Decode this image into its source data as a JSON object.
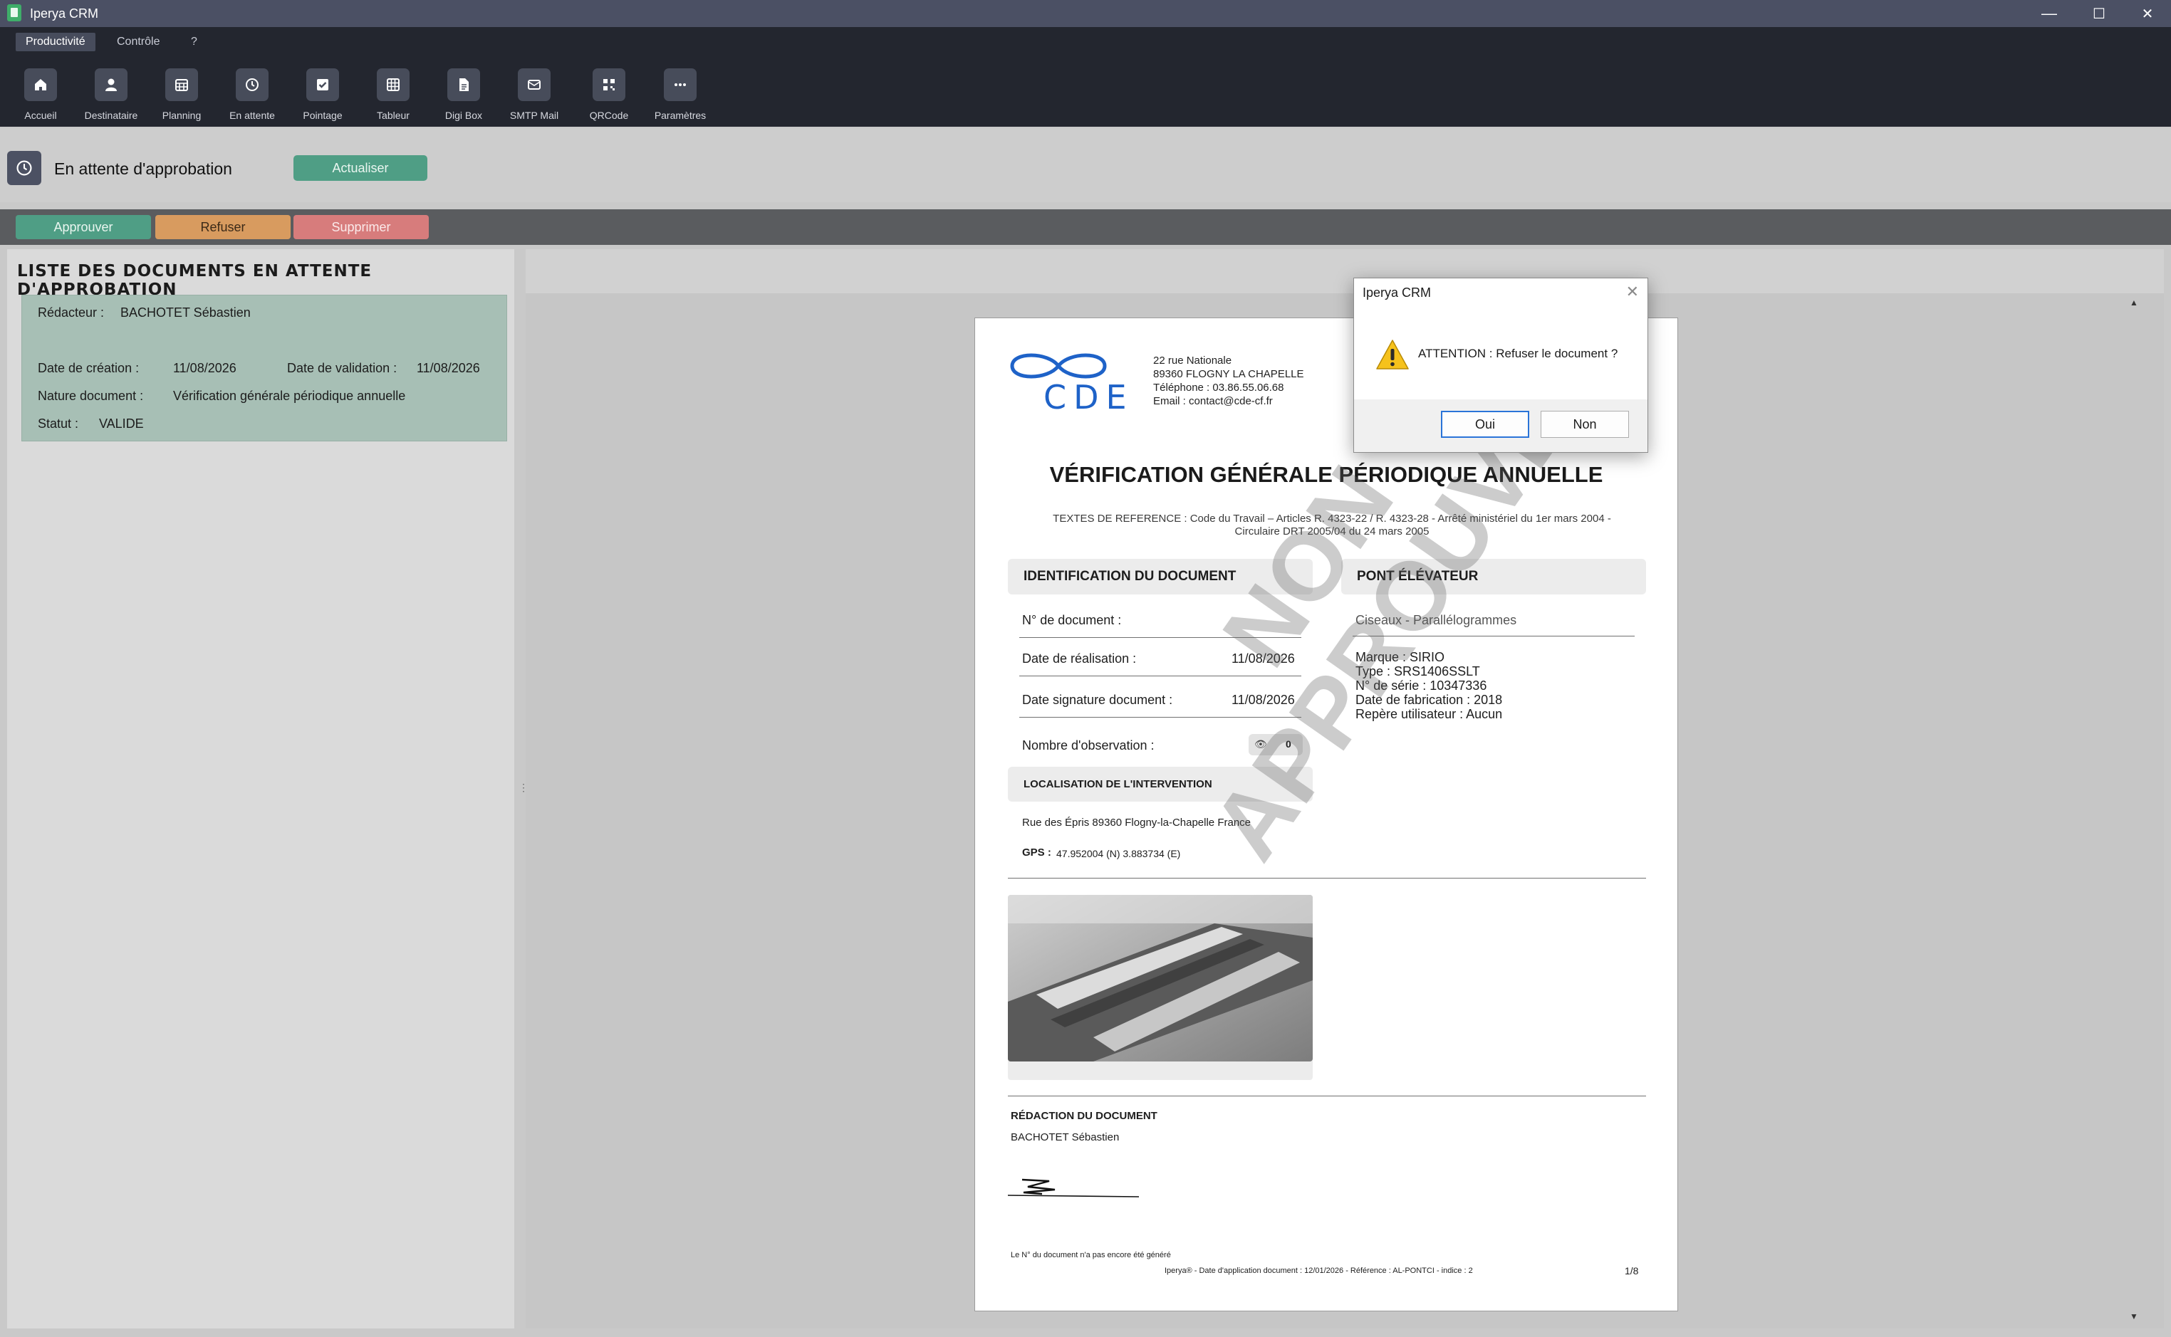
{
  "window": {
    "title": "Iperya CRM",
    "minimize": "—",
    "maximize": "☐",
    "close": "✕"
  },
  "menu": {
    "tabs": [
      "Productivité",
      "Contrôle",
      "?"
    ]
  },
  "ribbon": {
    "buttons": [
      {
        "label": "Accueil",
        "icon": "home-icon"
      },
      {
        "label": "Destinataire",
        "icon": "user-icon"
      },
      {
        "label": "Planning",
        "icon": "calendar-icon"
      },
      {
        "label": "En attente",
        "icon": "clock-icon"
      },
      {
        "label": "Pointage",
        "icon": "check-icon"
      },
      {
        "label": "Tableur",
        "icon": "grid-icon"
      },
      {
        "label": "Digi Box",
        "icon": "document-icon"
      },
      {
        "label": "SMTP Mail",
        "icon": "mail-icon"
      },
      {
        "label": "QRCode",
        "icon": "qrcode-icon"
      },
      {
        "label": "Paramètres",
        "icon": "more-icon"
      }
    ]
  },
  "header": {
    "title": "En attente d'approbation",
    "refresh_label": "Actualiser"
  },
  "actions": {
    "approve": "Approuver",
    "refuse": "Refuser",
    "delete": "Supprimer",
    "colors": {
      "approve": "#4f9e85",
      "refuse": "#d89b5f",
      "delete": "#d77c7c"
    }
  },
  "list": {
    "title": "LISTE DES DOCUMENTS EN ATTENTE D'APPROBATION",
    "item": {
      "author_label": "Rédacteur :",
      "author": "BACHOTET Sébastien",
      "created_label": "Date de création :",
      "created": "11/08/2026",
      "validated_label": "Date de validation :",
      "validated": "11/08/2026",
      "nature_label": "Nature document :",
      "nature": "Vérification générale périodique annuelle",
      "status_label": "Statut :",
      "status": "VALIDE"
    }
  },
  "document": {
    "company": {
      "logo_text": "CDE",
      "address1": "22 rue Nationale",
      "address2": "89360 FLOGNY LA CHAPELLE",
      "phone": "Téléphone : 03.86.55.06.68",
      "email": "Email : contact@cde-cf.fr"
    },
    "title": "VÉRIFICATION GÉNÉRALE PÉRIODIQUE ANNUELLE",
    "references": "TEXTES DE REFERENCE :  Code du Travail – Articles R. 4323-22 / R. 4323-28 - Arrêté ministériel du 1er mars 2004 - Circulaire DRT 2005/04 du 24 mars 2005",
    "identification": {
      "heading": "IDENTIFICATION DU DOCUMENT",
      "doc_number_label": "N° de document :",
      "doc_number": "",
      "date_realisation_label": "Date de réalisation :",
      "date_realisation": "11/08/2026",
      "date_signature_label": "Date signature document :",
      "date_signature": "11/08/2026",
      "observations_label": "Nombre d'observation :",
      "observations": "0"
    },
    "equipment": {
      "heading": "PONT ÉLÉVATEUR",
      "kind": "Ciseaux - Parallélogrammes",
      "marque": "Marque : SIRIO",
      "type": "Type : SRS1406SSLT",
      "serie": "N° de série : 10347336",
      "fabrication": "Date de fabrication : 2018",
      "repere": "Repère utilisateur : Aucun"
    },
    "location": {
      "heading": "LOCALISATION DE L'INTERVENTION",
      "address": "Rue des Épris 89360 Flogny-la-Chapelle France",
      "gps_label": "GPS :",
      "gps": "47.952004 (N)  3.883734 (E)"
    },
    "redaction": {
      "heading": "RÉDACTION DU DOCUMENT",
      "author": "BACHOTET Sébastien"
    },
    "watermark": "NON\nAPPROUVÉ",
    "footer_note": "Le N° du document n'a pas encore été généré",
    "footer": "Iperya® - Date d'application document : 12/01/2026 - Référence : AL-PONTCI - indice : 2",
    "page": "1/8"
  },
  "dialog": {
    "title": "Iperya CRM",
    "close": "✕",
    "message": "ATTENTION : Refuser le document ?",
    "yes": "Oui",
    "no": "Non"
  }
}
